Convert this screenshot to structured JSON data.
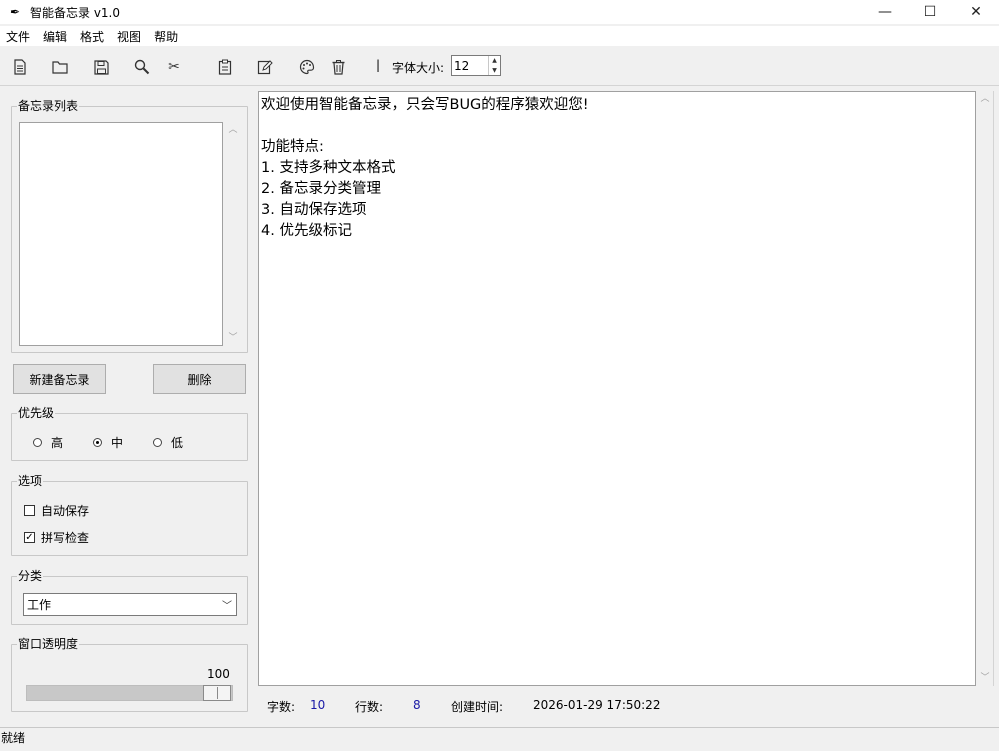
{
  "window": {
    "title": "智能备忘录 v1.0",
    "app_icon": "feather-icon",
    "controls": [
      "minimize-icon",
      "maximize-icon",
      "close-icon"
    ]
  },
  "menu": [
    "文件",
    "编辑",
    "格式",
    "视图",
    "帮助"
  ],
  "toolbar": {
    "icons": [
      "new-file-icon",
      "open-folder-icon",
      "save-icon",
      "search-icon",
      "scissors-icon",
      "clipboard-icon",
      "edit-icon",
      "palette-icon",
      "trash-icon"
    ],
    "separator": "|",
    "font_size_label": "字体大小:",
    "font_size_value": "12"
  },
  "sidebar": {
    "memo_list": {
      "title": "备忘录列表",
      "items": []
    },
    "new_button": "新建备忘录",
    "delete_button": "删除",
    "priority": {
      "title": "优先级",
      "options": [
        "高",
        "中",
        "低"
      ],
      "selected": "中"
    },
    "options": {
      "title": "选项",
      "autosave": {
        "label": "自动保存",
        "checked": false
      },
      "spellcheck": {
        "label": "拼写检查",
        "checked": true
      }
    },
    "category": {
      "title": "分类",
      "value": "工作"
    },
    "transparency": {
      "title": "窗口透明度",
      "value": "100"
    }
  },
  "editor": {
    "lines": [
      "欢迎使用智能备忘录，只会写BUG的程序猿欢迎您!",
      "",
      "功能特点:",
      "1. 支持多种文本格式",
      "2. 备忘录分类管理",
      "3. 自动保存选项",
      "4. 优先级标记"
    ]
  },
  "editor_status": {
    "char_label": "字数:",
    "char_count": "10",
    "line_label": "行数:",
    "line_count": "8",
    "created_label": "创建时间:",
    "created_value": "2026-01-29 17:50:22"
  },
  "statusbar": "就绪",
  "colors": {
    "count_text": "#1a1aa6",
    "background": "#f0f0f0"
  }
}
